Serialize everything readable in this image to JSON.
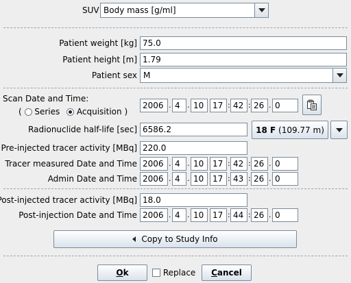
{
  "suv": {
    "label": "SUV",
    "selected": "Body mass [g/ml]"
  },
  "patient": {
    "weight_label": "Patient weight [kg]",
    "weight": "75.0",
    "height_label": "Patient height [m]",
    "height": "1.79",
    "sex_label": "Patient sex",
    "sex": "M"
  },
  "scan": {
    "label": "Scan Date and Time:",
    "paren_open": "(",
    "paren_close": ")",
    "radio_series": "Series",
    "radio_acquisition": "Acquisition",
    "selected": "Acquisition",
    "datetime": {
      "year": "2006",
      "month": "4",
      "day": "10",
      "hour": "17",
      "minute": "42",
      "second": "26",
      "ms": "0"
    }
  },
  "radionuclide": {
    "label": "Radionuclide half-life [sec]",
    "value": "6586.2",
    "isotope_bold": "18 F",
    "isotope_rest": "(109.77 m)"
  },
  "pre": {
    "activity_label": "Pre-injected tracer activity [MBq]",
    "activity": "220.0",
    "measured_label": "Tracer measured Date and Time",
    "measured": {
      "year": "2006",
      "month": "4",
      "day": "10",
      "hour": "17",
      "minute": "42",
      "second": "26",
      "ms": "0"
    },
    "admin_label": "Admin Date and Time",
    "admin": {
      "year": "2006",
      "month": "4",
      "day": "10",
      "hour": "17",
      "minute": "43",
      "second": "26",
      "ms": "0"
    }
  },
  "post": {
    "activity_label": "Post-injected tracer activity [MBq]",
    "activity": "18.0",
    "date_label": "Post-injection Date and Time",
    "datetime": {
      "year": "2006",
      "month": "4",
      "day": "10",
      "hour": "17",
      "minute": "44",
      "second": "26",
      "ms": "0"
    }
  },
  "buttons": {
    "copy": "Copy to Study Info",
    "ok_mnemonic": "O",
    "ok_rest": "k",
    "replace": "Replace",
    "cancel_mnemonic": "C",
    "cancel_rest": "ancel"
  },
  "separators": {
    "dot": ".",
    "colon": ":"
  },
  "icons": {
    "copy": "clipboard-icon",
    "arrow_left": "arrow-left-icon",
    "dropdown": "chevron-down-icon"
  }
}
